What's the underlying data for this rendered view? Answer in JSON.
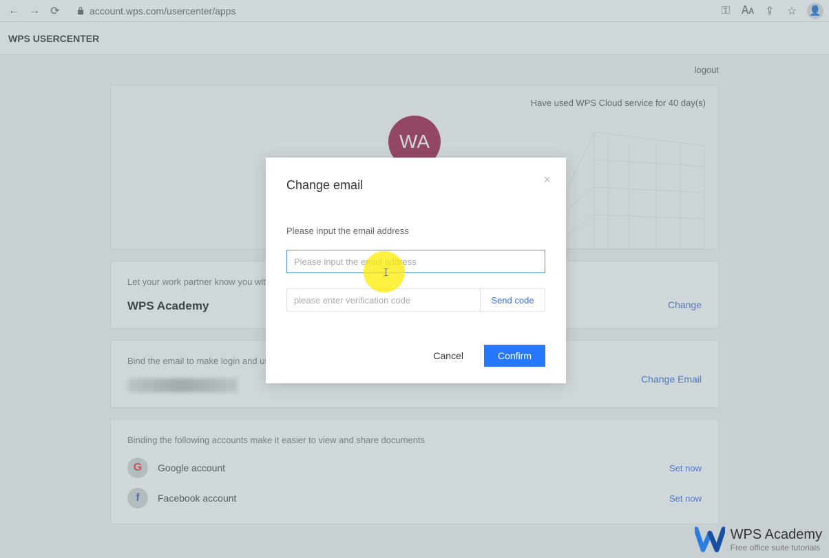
{
  "browser": {
    "url": "account.wps.com/usercenter/apps"
  },
  "header": {
    "title": "WPS USERCENTER"
  },
  "topbar": {
    "logout": "logout"
  },
  "hero": {
    "cloud_status": "Have used WPS Cloud service for 40 day(s)",
    "avatar_initials": "WA"
  },
  "nickname_card": {
    "desc": "Let your work partner know you with",
    "value": "WPS Academy",
    "link": "Change"
  },
  "email_card": {
    "desc": "Bind the email to make login and us",
    "link": "Change Email"
  },
  "accounts_card": {
    "desc": "Binding the following accounts make it easier to view and share documents",
    "google": {
      "label": "Google account",
      "action": "Set now"
    },
    "facebook": {
      "label": "Facebook account",
      "action": "Set now"
    }
  },
  "modal": {
    "title": "Change email",
    "label": "Please input the email address",
    "email_placeholder": "Please input the email address",
    "code_placeholder": "please enter verification code",
    "send_code": "Send code",
    "cancel": "Cancel",
    "confirm": "Confirm"
  },
  "watermark": {
    "title": "WPS Academy",
    "subtitle": "Free office suite tutorials"
  }
}
